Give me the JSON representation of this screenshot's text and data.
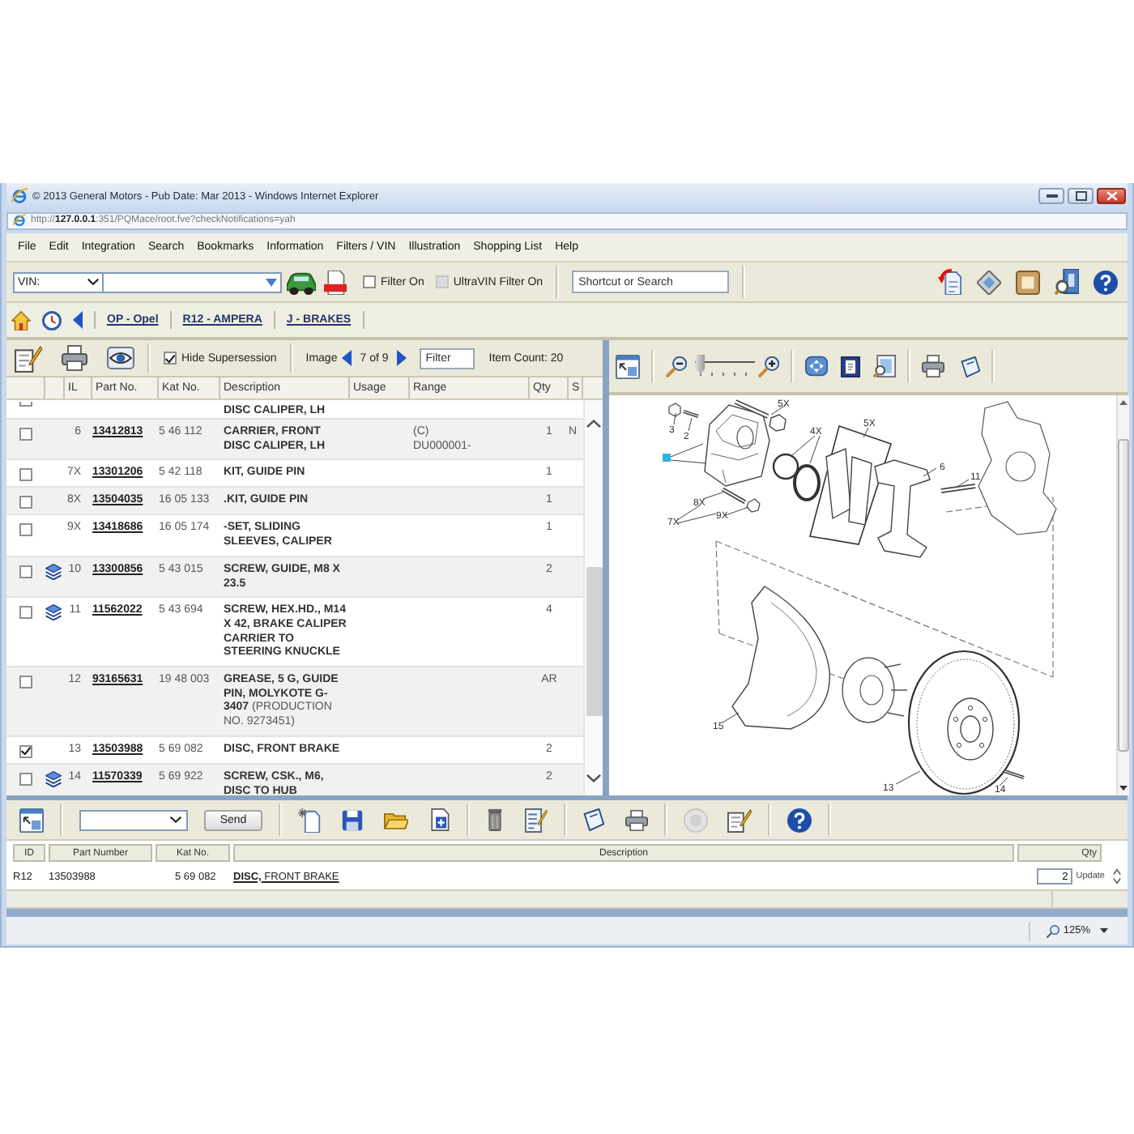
{
  "window": {
    "title": "© 2013 General Motors - Pub Date: Mar 2013 - Windows Internet Explorer"
  },
  "address_bar": {
    "url": "http://**127.0.0.1**:351/PQMace/root.fve?checkNotifications=yah"
  },
  "menu": [
    "File",
    "Edit",
    "Integration",
    "Search",
    "Bookmarks",
    "Information",
    "Filters / VIN",
    "Illustration",
    "Shopping List",
    "Help"
  ],
  "toolbar": {
    "vin_select": "VIN:",
    "filter_on": {
      "label": "Filter On",
      "checked": false
    },
    "ultravin_filter": {
      "label": "UltraVIN Filter On",
      "checked": false,
      "disabled": true
    },
    "search": {
      "placeholder": "Shortcut or Search"
    }
  },
  "breadcrumb": [
    "OP - Opel",
    "R12 - AMPERA",
    "J - BRAKES"
  ],
  "parts_list": {
    "hide_supersession": {
      "label": "Hide Supersession",
      "checked": true
    },
    "image_label": "Image",
    "image_position": "7 of 9",
    "filter": {
      "placeholder": "Filter"
    },
    "item_count": "Item Count: 20",
    "columns": [
      "IL",
      "Part No.",
      "Kat No.",
      "Description",
      "Usage",
      "Range",
      "Qty",
      "S"
    ],
    "rows": [
      {
        "kind": "partial",
        "checked": false,
        "description": "DISC CALIPER, LH"
      },
      {
        "kind": "part",
        "checked": false,
        "info": false,
        "il": "6",
        "part_no": "13412813",
        "kat_no": "5 46 112",
        "description": "CARRIER, FRONT DISC CALIPER, LH",
        "range": [
          "(C)",
          "DU000001-"
        ],
        "qty": "1",
        "s": "N"
      },
      {
        "kind": "part",
        "checked": false,
        "info": false,
        "il": "7X",
        "part_no": "13301206",
        "kat_no": "5 42 118",
        "description": "KIT, GUIDE PIN",
        "qty": "1"
      },
      {
        "kind": "part",
        "checked": false,
        "info": false,
        "il": "8X",
        "part_no": "13504035",
        "kat_no": "16 05 133",
        "description": ".KIT, GUIDE PIN",
        "qty": "1"
      },
      {
        "kind": "part",
        "checked": false,
        "info": false,
        "il": "9X",
        "part_no": "13418686",
        "kat_no": "16 05 174",
        "description": "-SET, SLIDING SLEEVES, CALIPER",
        "qty": "1"
      },
      {
        "kind": "part",
        "checked": false,
        "info": true,
        "il": "10",
        "part_no": "13300856",
        "kat_no": "5 43 015",
        "description": "SCREW, GUIDE, M8 X 23.5",
        "qty": "2"
      },
      {
        "kind": "part",
        "checked": false,
        "info": true,
        "il": "11",
        "part_no": "11562022",
        "kat_no": "5 43 694",
        "description": "SCREW, HEX.HD., M14 X 42, BRAKE CALIPER CARRIER TO STEERING KNUCKLE",
        "qty": "4"
      },
      {
        "kind": "part",
        "checked": false,
        "info": false,
        "il": "12",
        "part_no": "93165631",
        "kat_no": "19 48 003",
        "description": "GREASE, 5 G, GUIDE PIN, MOLYKOTE G-3407",
        "note": "(PRODUCTION NO. 9273451)",
        "qty": "AR"
      },
      {
        "kind": "part",
        "checked": true,
        "info": false,
        "il": "13",
        "part_no": "13503988",
        "kat_no": "5 69 082",
        "description": "DISC, FRONT BRAKE",
        "qty": "2"
      },
      {
        "kind": "part",
        "checked": false,
        "info": true,
        "il": "14",
        "part_no": "11570339",
        "kat_no": "5 69 922",
        "description": "SCREW, CSK., M6, DISC TO HUB",
        "qty": "2"
      }
    ]
  },
  "viewer": {
    "zoom_slider": {
      "level": 0.1
    },
    "callouts": [
      "3",
      "2",
      "5X",
      "4X",
      "5X",
      "6",
      "11",
      "8X",
      "7X",
      "9X",
      "15",
      "13",
      "14"
    ]
  },
  "bottom_toolbar": {
    "send_button": "Send"
  },
  "shopping_list": {
    "columns": [
      "ID",
      "Part Number",
      "Kat No.",
      "Description",
      "Qty"
    ],
    "rows": [
      {
        "id": "R12",
        "part_number": "13503988",
        "kat_no": "5 69 082",
        "description": "**DISC,** FRONT BRAKE",
        "qty": "2",
        "action": "Update"
      }
    ]
  },
  "status_bar": {
    "zoom": "125%"
  }
}
